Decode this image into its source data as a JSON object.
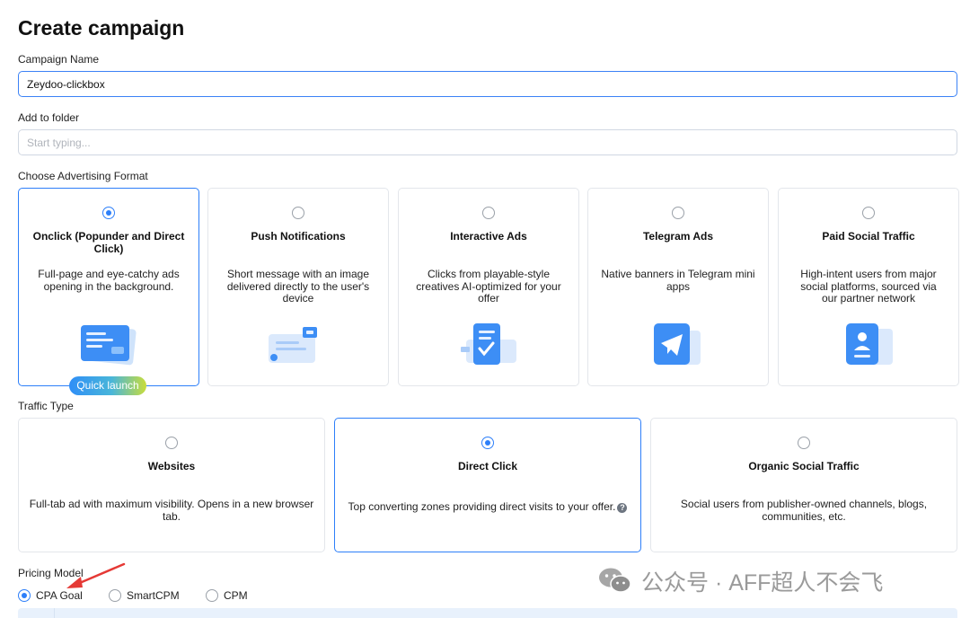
{
  "page": {
    "title": "Create campaign"
  },
  "campaign_name": {
    "label": "Campaign Name",
    "value": "Zeydoo-clickbox"
  },
  "folder": {
    "label": "Add to folder",
    "placeholder": "Start typing..."
  },
  "ad_format": {
    "label": "Choose Advertising Format",
    "selected_index": 0,
    "badge": "Quick launch",
    "options": [
      {
        "title": "Onclick (Popunder and Direct Click)",
        "description": "Full-page and eye-catchy ads opening in the background.",
        "icon": "popunder-window-icon"
      },
      {
        "title": "Push Notifications",
        "description": "Short message with an image delivered directly to the user's device",
        "icon": "push-notification-icon"
      },
      {
        "title": "Interactive Ads",
        "description": "Clicks from playable-style creatives AI-optimized for your offer",
        "icon": "interactive-checklist-icon"
      },
      {
        "title": "Telegram Ads",
        "description": "Native banners in Telegram mini apps",
        "icon": "telegram-plane-icon"
      },
      {
        "title": "Paid Social Traffic",
        "description": "High-intent users from major social platforms, sourced via our partner network",
        "icon": "social-profile-icon"
      }
    ]
  },
  "traffic_type": {
    "label": "Traffic Type",
    "selected_index": 1,
    "options": [
      {
        "title": "Websites",
        "description": "Full-tab ad with maximum visibility. Opens in a new browser tab."
      },
      {
        "title": "Direct Click",
        "description": "Top converting zones providing direct visits to your offer.",
        "help_icon": "question-circle-icon"
      },
      {
        "title": "Organic Social Traffic",
        "description": "Social users from publisher-owned channels, blogs, communities, etc."
      }
    ]
  },
  "pricing": {
    "label": "Pricing Model",
    "selected": "CPA Goal",
    "options": [
      "CPA Goal",
      "SmartCPM",
      "CPM"
    ]
  },
  "watermark": {
    "text": "公众号 · AFF超人不会飞",
    "icon": "wechat-icon"
  },
  "colors": {
    "accent": "#2d7ff9",
    "border": "#e3e6eb",
    "annotation_arrow": "#e53935"
  }
}
